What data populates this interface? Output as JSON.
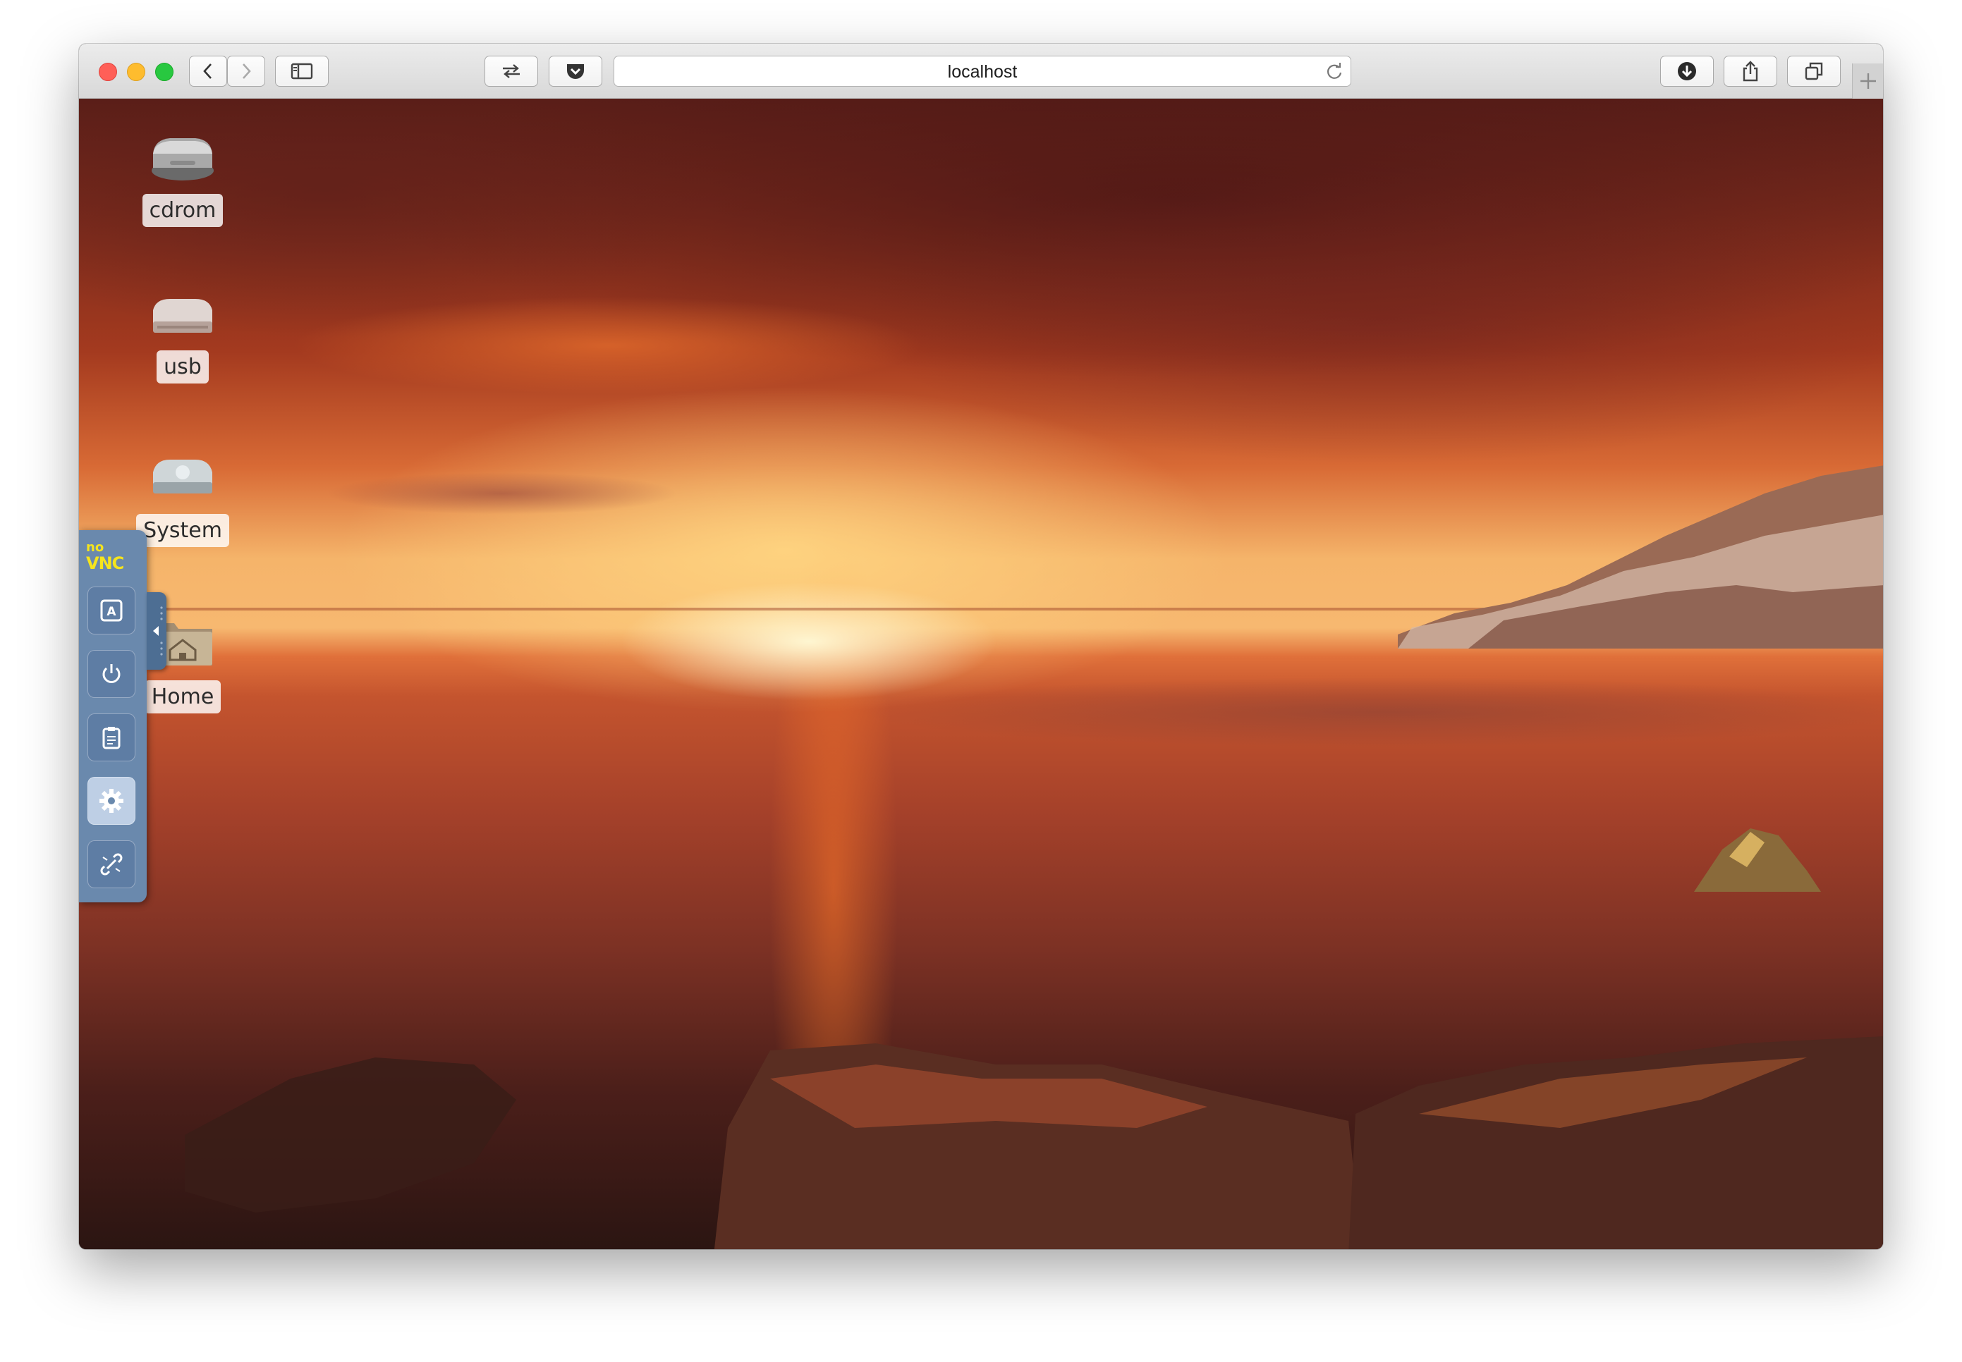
{
  "browser": {
    "url": "localhost"
  },
  "desktop": {
    "icons": [
      {
        "label": "cdrom",
        "icon": "optical-drive-icon"
      },
      {
        "label": "usb",
        "icon": "usb-drive-icon"
      },
      {
        "label": "System",
        "icon": "hard-drive-icon"
      },
      {
        "label": "Home",
        "icon": "home-folder-icon"
      }
    ]
  },
  "novnc": {
    "logo_top": "no",
    "logo_bottom": "VNC",
    "buttons": [
      {
        "icon": "keyboard-icon"
      },
      {
        "icon": "power-icon"
      },
      {
        "icon": "clipboard-icon"
      },
      {
        "icon": "gear-icon"
      },
      {
        "icon": "disconnect-icon"
      }
    ]
  },
  "colors": {
    "close": "#ff5f57",
    "minimize": "#febc2e",
    "zoom": "#28c840",
    "novnc_panel": "#6a89ad",
    "novnc_logo": "#f5e41d"
  }
}
